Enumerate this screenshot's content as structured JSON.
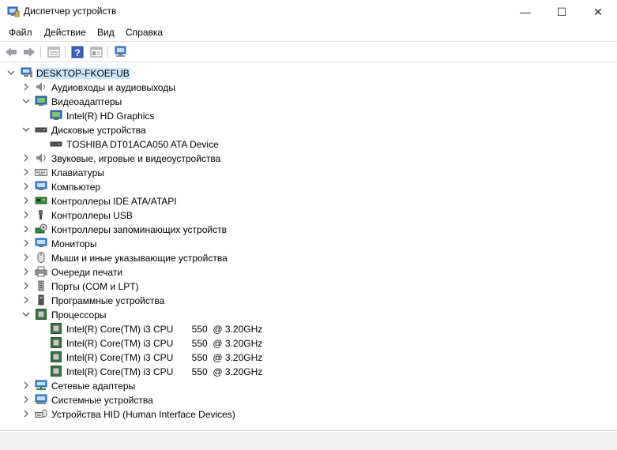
{
  "window": {
    "title": "Диспетчер устройств",
    "minimize": "—",
    "maximize": "☐",
    "close": "✕"
  },
  "menu": [
    "Файл",
    "Действие",
    "Вид",
    "Справка"
  ],
  "toolbar": {
    "buttons": [
      "back-icon",
      "forward-icon",
      "properties-icon",
      "help-icon",
      "view-icon",
      "scan-hardware-icon"
    ]
  },
  "tree": {
    "root": "DESKTOP-FKOEFUB",
    "nodes": [
      {
        "label": "Аудиовходы и аудиовыходы",
        "icon": "audio-io-icon",
        "expanded": false
      },
      {
        "label": "Видеоадаптеры",
        "icon": "display-adapter-icon",
        "expanded": true
      },
      {
        "label": "Intel(R) HD Graphics",
        "icon": "display-adapter-icon",
        "child": true
      },
      {
        "label": "Дисковые устройства",
        "icon": "disk-drive-icon",
        "expanded": true
      },
      {
        "label": "TOSHIBA DT01ACA050 ATA Device",
        "icon": "disk-drive-icon",
        "child": true
      },
      {
        "label": "Звуковые, игровые и видеоустройства",
        "icon": "sound-icon",
        "expanded": false
      },
      {
        "label": "Клавиатуры",
        "icon": "keyboard-icon",
        "expanded": false
      },
      {
        "label": "Компьютер",
        "icon": "computer-icon",
        "expanded": false
      },
      {
        "label": "Контроллеры IDE ATA/ATAPI",
        "icon": "ide-controller-icon",
        "expanded": false
      },
      {
        "label": "Контроллеры USB",
        "icon": "usb-icon",
        "expanded": false
      },
      {
        "label": "Контроллеры запоминающих устройств",
        "icon": "storage-controller-icon",
        "expanded": false
      },
      {
        "label": "Мониторы",
        "icon": "monitor-icon",
        "expanded": false
      },
      {
        "label": "Мыши и иные указывающие устройства",
        "icon": "mouse-icon",
        "expanded": false
      },
      {
        "label": "Очереди печати",
        "icon": "printer-icon",
        "expanded": false
      },
      {
        "label": "Порты (COM и LPT)",
        "icon": "port-icon",
        "expanded": false
      },
      {
        "label": "Программные устройства",
        "icon": "software-device-icon",
        "expanded": false
      },
      {
        "label": "Процессоры",
        "icon": "processor-icon",
        "expanded": true
      },
      {
        "label": "Intel(R) Core(TM) i3 CPU       550  @ 3.20GHz",
        "icon": "processor-icon",
        "child": true
      },
      {
        "label": "Intel(R) Core(TM) i3 CPU       550  @ 3.20GHz",
        "icon": "processor-icon",
        "child": true
      },
      {
        "label": "Intel(R) Core(TM) i3 CPU       550  @ 3.20GHz",
        "icon": "processor-icon",
        "child": true
      },
      {
        "label": "Intel(R) Core(TM) i3 CPU       550  @ 3.20GHz",
        "icon": "processor-icon",
        "child": true
      },
      {
        "label": "Сетевые адаптеры",
        "icon": "network-adapter-icon",
        "expanded": false
      },
      {
        "label": "Системные устройства",
        "icon": "system-device-icon",
        "expanded": false
      },
      {
        "label": "Устройства HID (Human Interface Devices)",
        "icon": "hid-icon",
        "expanded": false
      }
    ]
  }
}
